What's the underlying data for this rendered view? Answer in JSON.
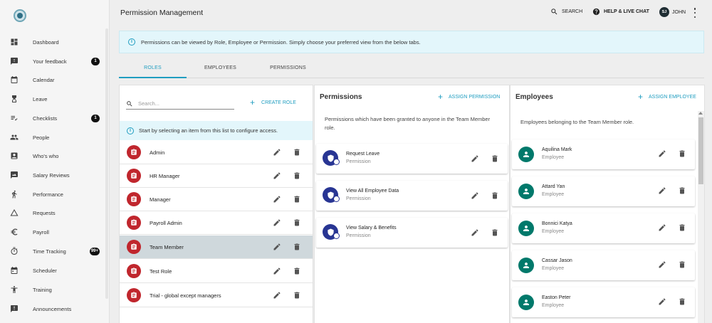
{
  "sidebar": {
    "items": [
      {
        "label": "Dashboard",
        "icon": "dashboard-icon",
        "badge": ""
      },
      {
        "label": "Your feedback",
        "icon": "feedback-icon",
        "badge": "1"
      },
      {
        "label": "Calendar",
        "icon": "calendar-icon",
        "badge": ""
      },
      {
        "label": "Leave",
        "icon": "leave-icon",
        "badge": ""
      },
      {
        "label": "Checklists",
        "icon": "checklist-icon",
        "badge": "1"
      },
      {
        "label": "People",
        "icon": "people-icon",
        "badge": ""
      },
      {
        "label": "Who's who",
        "icon": "whos-who-icon",
        "badge": ""
      },
      {
        "label": "Salary Reviews",
        "icon": "salary-reviews-icon",
        "badge": ""
      },
      {
        "label": "Performance",
        "icon": "performance-icon",
        "badge": ""
      },
      {
        "label": "Requests",
        "icon": "requests-icon",
        "badge": ""
      },
      {
        "label": "Payroll",
        "icon": "payroll-icon",
        "badge": ""
      },
      {
        "label": "Time Tracking",
        "icon": "time-tracking-icon",
        "badge": "99+"
      },
      {
        "label": "Scheduler",
        "icon": "scheduler-icon",
        "badge": ""
      },
      {
        "label": "Training",
        "icon": "training-icon",
        "badge": ""
      },
      {
        "label": "Announcements",
        "icon": "announcements-icon",
        "badge": ""
      }
    ]
  },
  "header": {
    "title": "Permission Management",
    "search_label": "SEARCH",
    "help_label": "HELP & LIVE CHAT",
    "user_initials": "SJ",
    "user_name": "JOHN"
  },
  "info_text": "Permissions can be viewed by Role, Employee or Permission. Simply choose your preferred view from the below tabs.",
  "tabs": [
    {
      "label": "ROLES",
      "active": true
    },
    {
      "label": "EMPLOYEES",
      "active": false
    },
    {
      "label": "PERMISSIONS",
      "active": false
    }
  ],
  "roles": {
    "search_placeholder": "Search...",
    "create_label": "CREATE ROLE",
    "info_text": "Start by selecting an item from this list to configure access.",
    "items": [
      {
        "label": "Admin",
        "selected": false
      },
      {
        "label": "HR Manager",
        "selected": false
      },
      {
        "label": "Manager",
        "selected": false
      },
      {
        "label": "Payroll Admin",
        "selected": false
      },
      {
        "label": "Team Member",
        "selected": true
      },
      {
        "label": "Test Role",
        "selected": false
      },
      {
        "label": "Trial - global except managers",
        "selected": false
      }
    ]
  },
  "permissions": {
    "title": "Permissions",
    "action_label": "ASSIGN PERMISSION",
    "description": "Permissions which have been granted to anyone in the Team Member role.",
    "items": [
      {
        "title": "Request Leave",
        "subtitle": "Permission"
      },
      {
        "title": "View All Employee Data",
        "subtitle": "Permission"
      },
      {
        "title": "View Salary & Benefits",
        "subtitle": "Permission"
      }
    ]
  },
  "employees": {
    "title": "Employees",
    "action_label": "ASSIGN EMPLOYEE",
    "description": "Employees belonging to the Team Member role.",
    "items": [
      {
        "name": "Aquilina Mark",
        "subtitle": "Employee"
      },
      {
        "name": "Attard Yan",
        "subtitle": "Employee"
      },
      {
        "name": "Bonnici Katya",
        "subtitle": "Employee"
      },
      {
        "name": "Cassar Jason",
        "subtitle": "Employee"
      },
      {
        "name": "Easton Peter",
        "subtitle": "Employee"
      }
    ]
  },
  "colors": {
    "accent": "#1f9dc0",
    "role_icon": "#c0262d",
    "permission_icon": "#283593",
    "employee_icon": "#00796b",
    "selected_row": "#cfd8dc"
  }
}
